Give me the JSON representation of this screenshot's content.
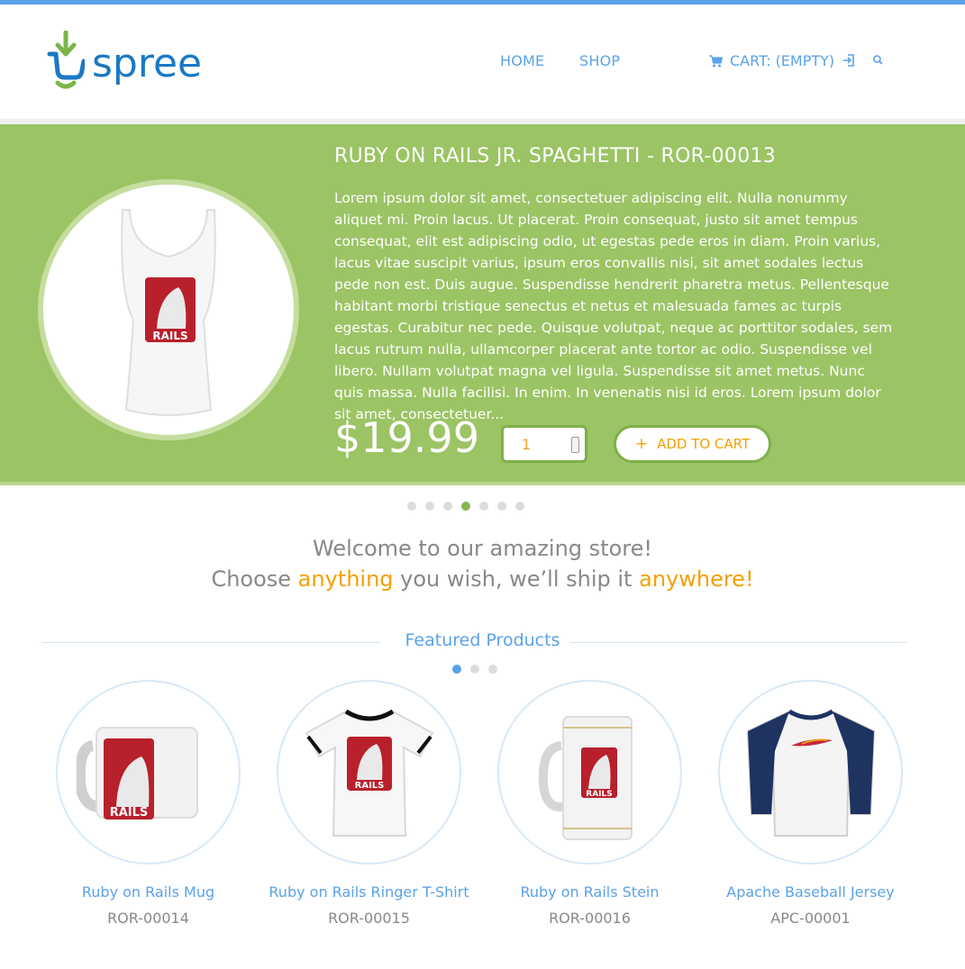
{
  "brand": {
    "name": "spree"
  },
  "nav": {
    "home": "HOME",
    "shop": "SHOP",
    "cart": "CART: (EMPTY)"
  },
  "hero": {
    "title": "RUBY ON RAILS JR. SPAGHETTI - ROR-00013",
    "description": "Lorem ipsum dolor sit amet, consectetuer adipiscing elit. Nulla nonummy aliquet mi. Proin lacus. Ut placerat. Proin consequat, justo sit amet tempus consequat, elit est adipiscing odio, ut egestas pede eros in diam. Proin varius, lacus vitae suscipit varius, ipsum eros convallis nisi, sit amet sodales lectus pede non est. Duis augue. Suspendisse hendrerit pharetra metus. Pellentesque habitant morbi tristique senectus et netus et malesuada fames ac turpis egestas. Curabitur nec pede. Quisque volutpat, neque ac porttitor sodales, sem lacus rutrum nulla, ullamcorper placerat ante tortor ac odio. Suspendisse vel libero. Nullam volutpat magna vel ligula. Suspendisse sit amet metus. Nunc quis massa. Nulla facilisi. In enim. In venenatis nisi id eros. Lorem ipsum dolor sit amet, consectetuer...",
    "price": "$19.99",
    "quantity": "1",
    "add_to_cart": "ADD TO CART",
    "add_icon": "+",
    "image_badge": "RAILS"
  },
  "hero_slider": {
    "count": 7,
    "active_index": 3
  },
  "welcome": {
    "line1": "Welcome to our amazing store!",
    "line2_a": "Choose ",
    "line2_b": "anything",
    "line2_c": " you wish, we’ll ship it ",
    "line2_d": "anywhere!"
  },
  "featured": {
    "title": "Featured Products",
    "slider": {
      "count": 3,
      "active_index": 0
    },
    "products": [
      {
        "name": "Ruby on Rails Mug",
        "sku": "ROR-00014",
        "badge": "RAILS"
      },
      {
        "name": "Ruby on Rails Ringer T-Shirt",
        "sku": "ROR-00015",
        "badge": "RAILS"
      },
      {
        "name": "Ruby on Rails Stein",
        "sku": "ROR-00016",
        "badge": "RAILS"
      },
      {
        "name": "Apache Baseball Jersey",
        "sku": "APC-00001"
      }
    ]
  },
  "colors": {
    "accent_blue": "#5aa2e8",
    "hero_green": "#9bc465",
    "highlight_orange": "#f5a000",
    "rails_red": "#b8202c"
  }
}
